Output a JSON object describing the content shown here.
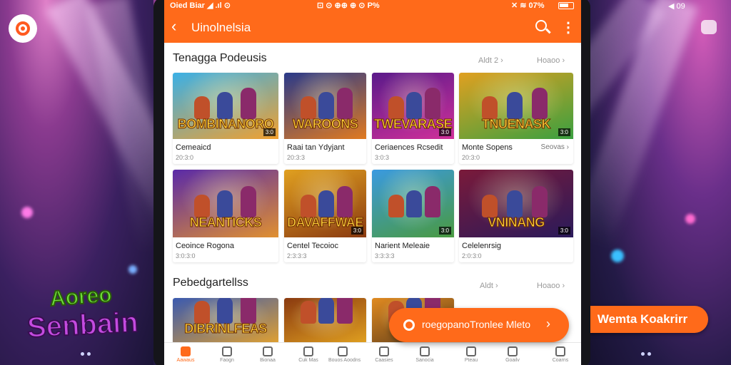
{
  "background": {
    "top_left_logo_icon": "target-icon",
    "right_status": "◀ 09",
    "game_logo": {
      "line1": "Aoreo",
      "line2": "Senbain"
    },
    "right_cta_label": "Wemta Koakrirr"
  },
  "statusbar": {
    "left": "Oied Biar  ◢ .ıl  ⊙",
    "middle": "⊡ ⊙  ⊕⊕ ⊕ ⊙ P%",
    "right": "✕ ≋ 07%"
  },
  "appbar": {
    "title": "Uinolnelsia",
    "back_icon": "chevron-left-icon",
    "search_icon": "search-icon",
    "more_icon": "more-vert-icon"
  },
  "section1": {
    "title": "Tenagga Podeusis",
    "link1": "Aldt 2  ›",
    "link2": "Hoaoo ›",
    "cards": [
      {
        "logo": "BOMBINANORO",
        "badge": "3:0",
        "name": "Cemeaicd",
        "meta": "20:3:0",
        "rating": "",
        "colors": [
          "#3bb0e6",
          "#f0a030"
        ]
      },
      {
        "logo": "WAROONS",
        "badge": "",
        "name": "Raai tan Ydyjant",
        "meta": "20:3:3",
        "rating": "",
        "colors": [
          "#2a3a8a",
          "#e07a20"
        ]
      },
      {
        "logo": "TWEVARASE",
        "badge": "3:0",
        "name": "Ceriaences Rcsedit",
        "meta": "3:0:3",
        "rating": "",
        "colors": [
          "#5a1a8a",
          "#d0309a"
        ]
      },
      {
        "logo": "TNUENASK",
        "badge": "3:0",
        "name": "Monte Sopens",
        "meta": "20:3:0",
        "rating": "Seovas ›",
        "colors": [
          "#e0a020",
          "#3aa040"
        ]
      }
    ]
  },
  "section1_row2": {
    "cards": [
      {
        "logo": "NEANTICKS",
        "badge": "",
        "name": "Ceoince Rogona",
        "meta": "3:0:3:0",
        "rating": "",
        "colors": [
          "#5a2aa8",
          "#e09030"
        ]
      },
      {
        "logo": "DAVAFFWAE",
        "badge": "3:0",
        "name": "Centel Tecoioc",
        "meta": "2:3:3:3",
        "rating": "",
        "colors": [
          "#e0a020",
          "#8a3a10"
        ]
      },
      {
        "logo": "",
        "badge": "3:0",
        "name": "Narient Meleaie",
        "meta": "3:3:3:3",
        "rating": "",
        "colors": [
          "#3a9ae0",
          "#4a9a40"
        ]
      },
      {
        "logo": "VNINANG",
        "badge": "3:0",
        "name": "Celelenrsig",
        "meta": "2:0:3:0",
        "rating": "",
        "colors": [
          "#7a1a3a",
          "#2a1a5a"
        ]
      }
    ]
  },
  "section2": {
    "title": "Pebedgartellss",
    "link1": "Aldt ›",
    "link2": "Hoaoo ›",
    "cards": [
      {
        "logo": "DIBRINLFEAS",
        "colors": [
          "#3a5ab0",
          "#e0a030"
        ]
      },
      {
        "logo": "",
        "colors": [
          "#8a3a10",
          "#e0a020"
        ]
      },
      {
        "logo": "",
        "colors": [
          "#e08a20",
          "#5a3a1a"
        ]
      }
    ]
  },
  "fab": {
    "label": "roegopanoTronlee Mleto",
    "chevron": "›"
  },
  "bottomnav": {
    "items": [
      {
        "label": "Aawaus",
        "icon": "home-icon",
        "active": true
      },
      {
        "label": "Faogn",
        "icon": "document-icon"
      },
      {
        "label": "Bionaa",
        "icon": "upload-icon"
      },
      {
        "label": "Cuk Mas",
        "icon": "globe-icon"
      },
      {
        "label": "Bouos Aoodns",
        "icon": "fire-icon"
      },
      {
        "label": "Caasies",
        "icon": "box-icon"
      },
      {
        "label": "Sanocia",
        "icon": "gift-icon"
      },
      {
        "label": "Pteau",
        "icon": "gamepad-icon"
      },
      {
        "label": "Goailv",
        "icon": "chat-icon"
      },
      {
        "label": "Coarns",
        "icon": "user-icon"
      }
    ]
  }
}
